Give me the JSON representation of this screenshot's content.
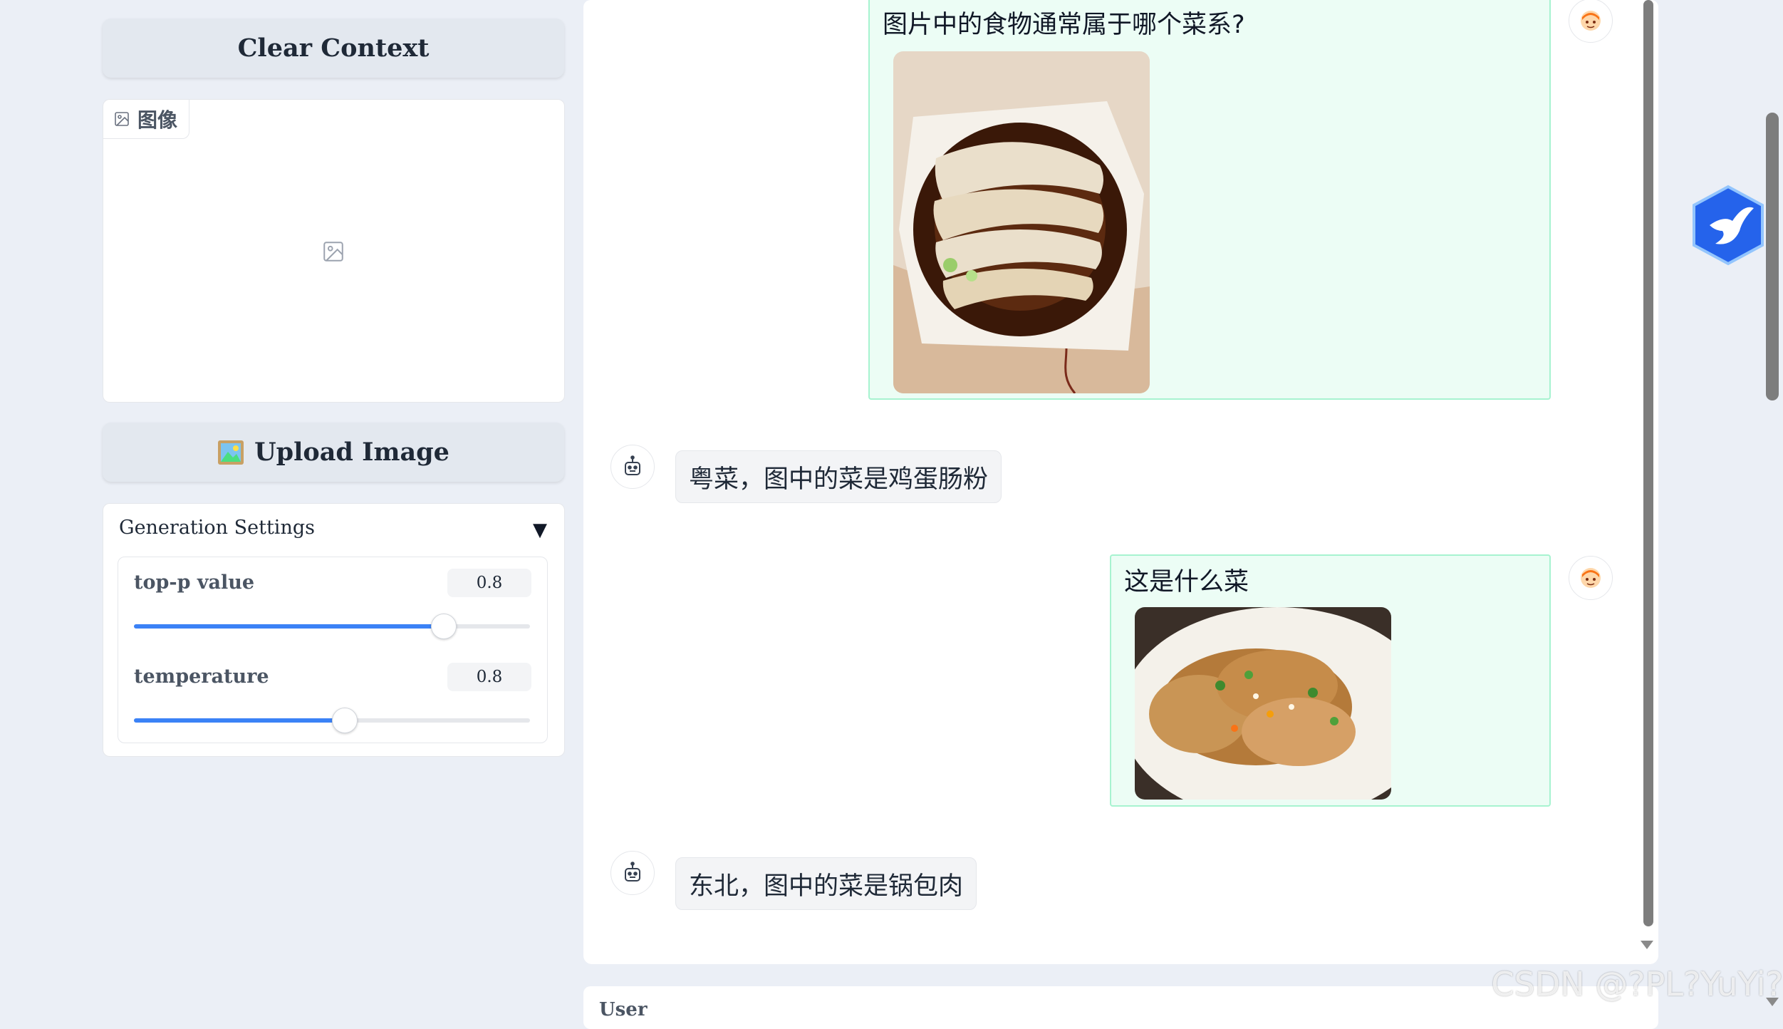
{
  "left_panel": {
    "clear_context": "Clear Context",
    "image_label": "图像",
    "upload_image": "Upload Image",
    "generation_settings": {
      "title": "Generation Settings",
      "toggle": "▼",
      "sliders": [
        {
          "label": "top-p value",
          "value": "0.8",
          "fraction": 0.78
        },
        {
          "label": "temperature",
          "value": "0.8",
          "fraction": 0.53
        }
      ]
    }
  },
  "chat": {
    "messages": [
      {
        "role": "user",
        "text": "图片中的食物通常属于哪个菜系?",
        "image": "cheung-fun-photo",
        "avatar": "user-avatar-icon"
      },
      {
        "role": "bot",
        "text": "粤菜，图中的菜是鸡蛋肠粉",
        "avatar": "robot-avatar-icon"
      },
      {
        "role": "user",
        "text": "这是什么菜",
        "image": "guo-bao-rou-photo",
        "avatar": "user-avatar-icon"
      },
      {
        "role": "bot",
        "text": "东北，图中的菜是锅包肉",
        "avatar": "robot-avatar-icon"
      }
    ]
  },
  "input": {
    "label": "User"
  },
  "watermark": "CSDN @?PL?YuYi?",
  "colors": {
    "accent": "#3b82f6",
    "user_bubble": "#ecfdf5",
    "user_border": "#a7f3d0",
    "background": "#ebeff6"
  }
}
